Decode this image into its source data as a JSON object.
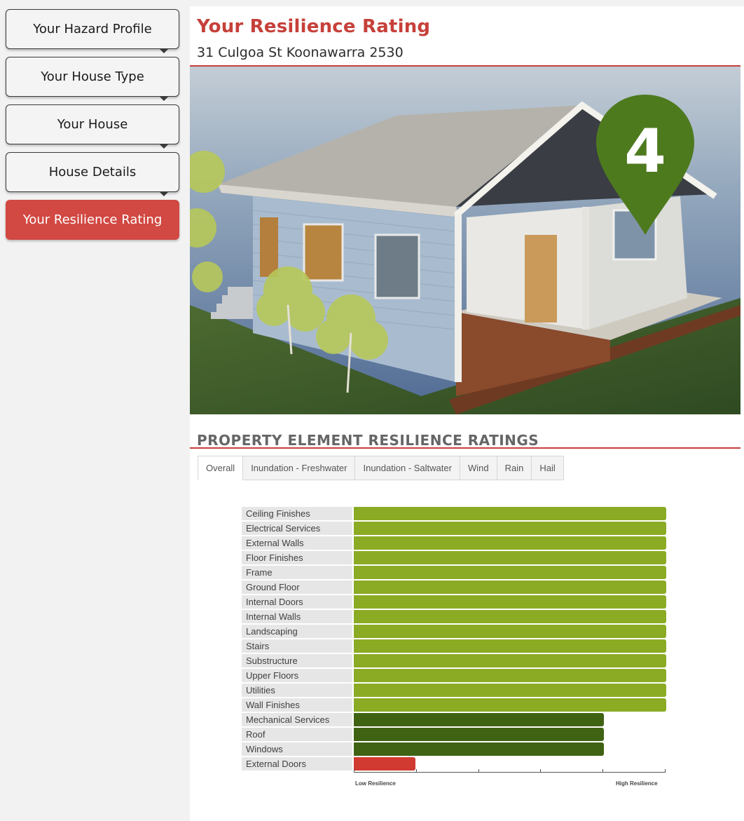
{
  "sidebar": {
    "items": [
      {
        "label": "Your Hazard Profile",
        "name": "your-hazard-profile",
        "active": false
      },
      {
        "label": "Your House Type",
        "name": "your-house-type",
        "active": false
      },
      {
        "label": "Your House",
        "name": "your-house",
        "active": false
      },
      {
        "label": "House Details",
        "name": "house-details",
        "active": false
      },
      {
        "label": "Your Resilience Rating",
        "name": "your-resilience-rating",
        "active": true
      }
    ]
  },
  "header": {
    "title": "Your Resilience Rating",
    "address": "31 Culgoa St Koonawarra 2530"
  },
  "rating_marker": {
    "value": "4",
    "color": "#4e7a1e",
    "icon": "map-pin-icon"
  },
  "section": {
    "title": "PROPERTY ELEMENT RESILIENCE RATINGS"
  },
  "tabs": [
    {
      "label": "Overall",
      "active": true
    },
    {
      "label": "Inundation - Freshwater",
      "active": false
    },
    {
      "label": "Inundation - Saltwater",
      "active": false
    },
    {
      "label": "Wind",
      "active": false
    },
    {
      "label": "Rain",
      "active": false
    },
    {
      "label": "Hail",
      "active": false
    }
  ],
  "colors": {
    "accent": "#c6403a",
    "high": "#8aab23",
    "medium": "#3f6313",
    "low": "#d03a30"
  },
  "chart_data": {
    "type": "bar",
    "orientation": "horizontal",
    "categories": [
      "Ceiling Finishes",
      "Electrical Services",
      "External Walls",
      "Floor Finishes",
      "Frame",
      "Ground Floor",
      "Internal Doors",
      "Internal Walls",
      "Landscaping",
      "Stairs",
      "Substructure",
      "Upper Floors",
      "Utilities",
      "Wall Finishes",
      "Mechanical Services",
      "Roof",
      "Windows",
      "External Doors"
    ],
    "values": [
      5,
      5,
      5,
      5,
      5,
      5,
      5,
      5,
      5,
      5,
      5,
      5,
      5,
      5,
      4,
      4,
      4,
      1
    ],
    "xlim": [
      0,
      5
    ],
    "xlabel_min": "Low Resilience",
    "xlabel_max": "High Resilience",
    "grid": false
  }
}
